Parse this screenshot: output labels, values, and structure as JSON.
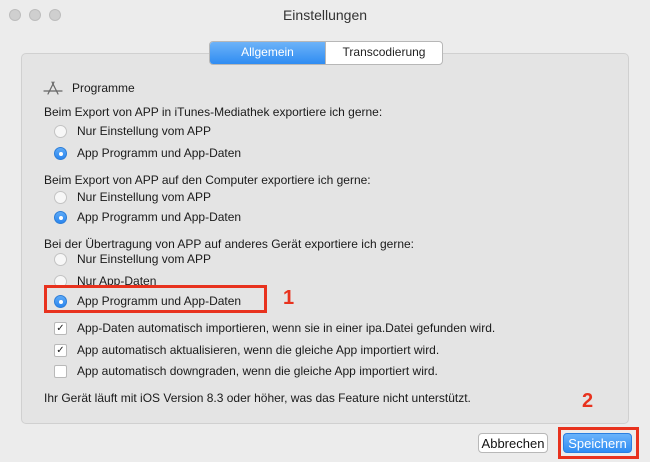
{
  "window": {
    "title": "Einstellungen"
  },
  "tabs": [
    {
      "label": "Allgemein",
      "active": true
    },
    {
      "label": "Transcodierung",
      "active": false
    }
  ],
  "section": {
    "icon": "app-store-icon",
    "title": "Programme"
  },
  "groups": [
    {
      "heading": "Beim Export von APP in iTunes-Mediathek exportiere ich gerne:",
      "options": [
        {
          "label": "Nur Einstellung vom APP",
          "selected": false
        },
        {
          "label": "App Programm und App-Daten",
          "selected": true
        }
      ]
    },
    {
      "heading": "Beim Export von APP auf den Computer exportiere ich gerne:",
      "options": [
        {
          "label": "Nur Einstellung vom APP",
          "selected": false
        },
        {
          "label": "App Programm und App-Daten",
          "selected": true
        }
      ]
    },
    {
      "heading": "Bei der Übertragung von APP auf anderes Gerät exportiere ich gerne:",
      "options": [
        {
          "label": "Nur Einstellung vom APP",
          "selected": false
        },
        {
          "label": "Nur App-Daten",
          "selected": false
        },
        {
          "label": "App Programm und App-Daten",
          "selected": true
        }
      ]
    }
  ],
  "checkboxes": [
    {
      "label": "App-Daten automatisch importieren, wenn sie in einer ipa.Datei gefunden wird.",
      "checked": true
    },
    {
      "label": "App automatisch aktualisieren, wenn die gleiche App importiert wird.",
      "checked": true
    },
    {
      "label": "App automatisch downgraden, wenn die gleiche App importiert wird.",
      "checked": false
    }
  ],
  "note": "Ihr Gerät läuft mit iOS Version 8.3 oder höher, was das Feature nicht unterstützt.",
  "annotations": {
    "marker1": "1",
    "marker2": "2",
    "color": "#e8321e"
  },
  "buttons": {
    "cancel": "Abbrechen",
    "save": "Speichern"
  },
  "colors": {
    "accent": "#2f8cf2"
  }
}
